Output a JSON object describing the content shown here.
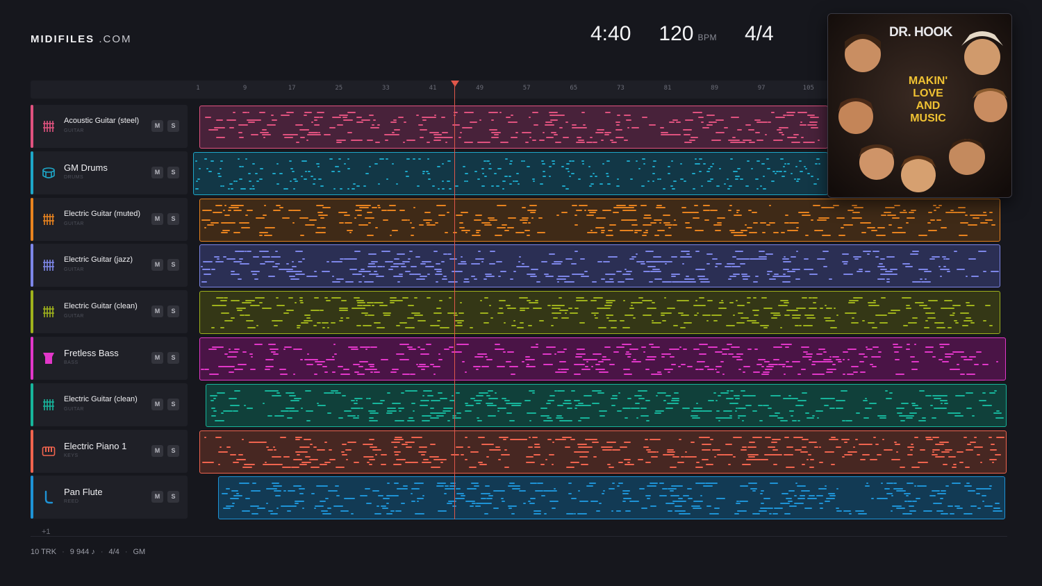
{
  "brand": {
    "name": "MIDIFILES",
    "suffix": ".COM"
  },
  "header": {
    "duration": "4:40",
    "tempo": "120",
    "tempo_unit": "BPM",
    "time_signature": "4/4"
  },
  "ruler": {
    "ticks": [
      "1",
      "9",
      "17",
      "25",
      "33",
      "41",
      "49",
      "57",
      "65",
      "73",
      "81",
      "89",
      "97",
      "105"
    ]
  },
  "tracks": [
    {
      "name": "Acoustic Guitar (steel)",
      "category": "GUITAR",
      "color": "#e0527f",
      "fill": "#48223a",
      "icon": "guitar-grid-icon",
      "mute": "M",
      "solo": "S"
    },
    {
      "name": "GM Drums",
      "category": "DRUMS",
      "color": "#1ea7c8",
      "fill": "#123746",
      "icon": "drum-icon",
      "mute": "M",
      "solo": "S"
    },
    {
      "name": "Electric Guitar (muted)",
      "category": "GUITAR",
      "color": "#e8831f",
      "fill": "#3f2a17",
      "icon": "guitar-grid-icon",
      "mute": "M",
      "solo": "S"
    },
    {
      "name": "Electric Guitar (jazz)",
      "category": "GUITAR",
      "color": "#7d86e8",
      "fill": "#2b2f54",
      "icon": "guitar-grid-icon",
      "mute": "M",
      "solo": "S"
    },
    {
      "name": "Electric Guitar (clean)",
      "category": "GUITAR",
      "color": "#9fb21c",
      "fill": "#343716",
      "icon": "guitar-grid-icon",
      "mute": "M",
      "solo": "S"
    },
    {
      "name": "Fretless Bass",
      "category": "BASS",
      "color": "#e237c9",
      "fill": "#4a1446",
      "icon": "bass-icon",
      "mute": "M",
      "solo": "S"
    },
    {
      "name": "Electric Guitar (clean)",
      "category": "GUITAR",
      "color": "#17b59b",
      "fill": "#10403a",
      "icon": "guitar-grid-icon",
      "mute": "M",
      "solo": "S"
    },
    {
      "name": "Electric Piano 1",
      "category": "KEYS",
      "color": "#f0644e",
      "fill": "#472722",
      "icon": "piano-icon",
      "mute": "M",
      "solo": "S"
    },
    {
      "name": "Pan Flute",
      "category": "REED",
      "color": "#1e93d6",
      "fill": "#123a54",
      "icon": "flute-icon",
      "mute": "M",
      "solo": "S"
    }
  ],
  "more_tracks": "+1",
  "footer": {
    "tracks": "10 TRK",
    "notes": "9 944 ♪",
    "meter": "4/4",
    "standard": "GM"
  },
  "album": {
    "artist": "DR. HOOK",
    "title_lines": [
      "MAKIN'",
      "LOVE",
      "AND",
      "MUSIC"
    ]
  }
}
